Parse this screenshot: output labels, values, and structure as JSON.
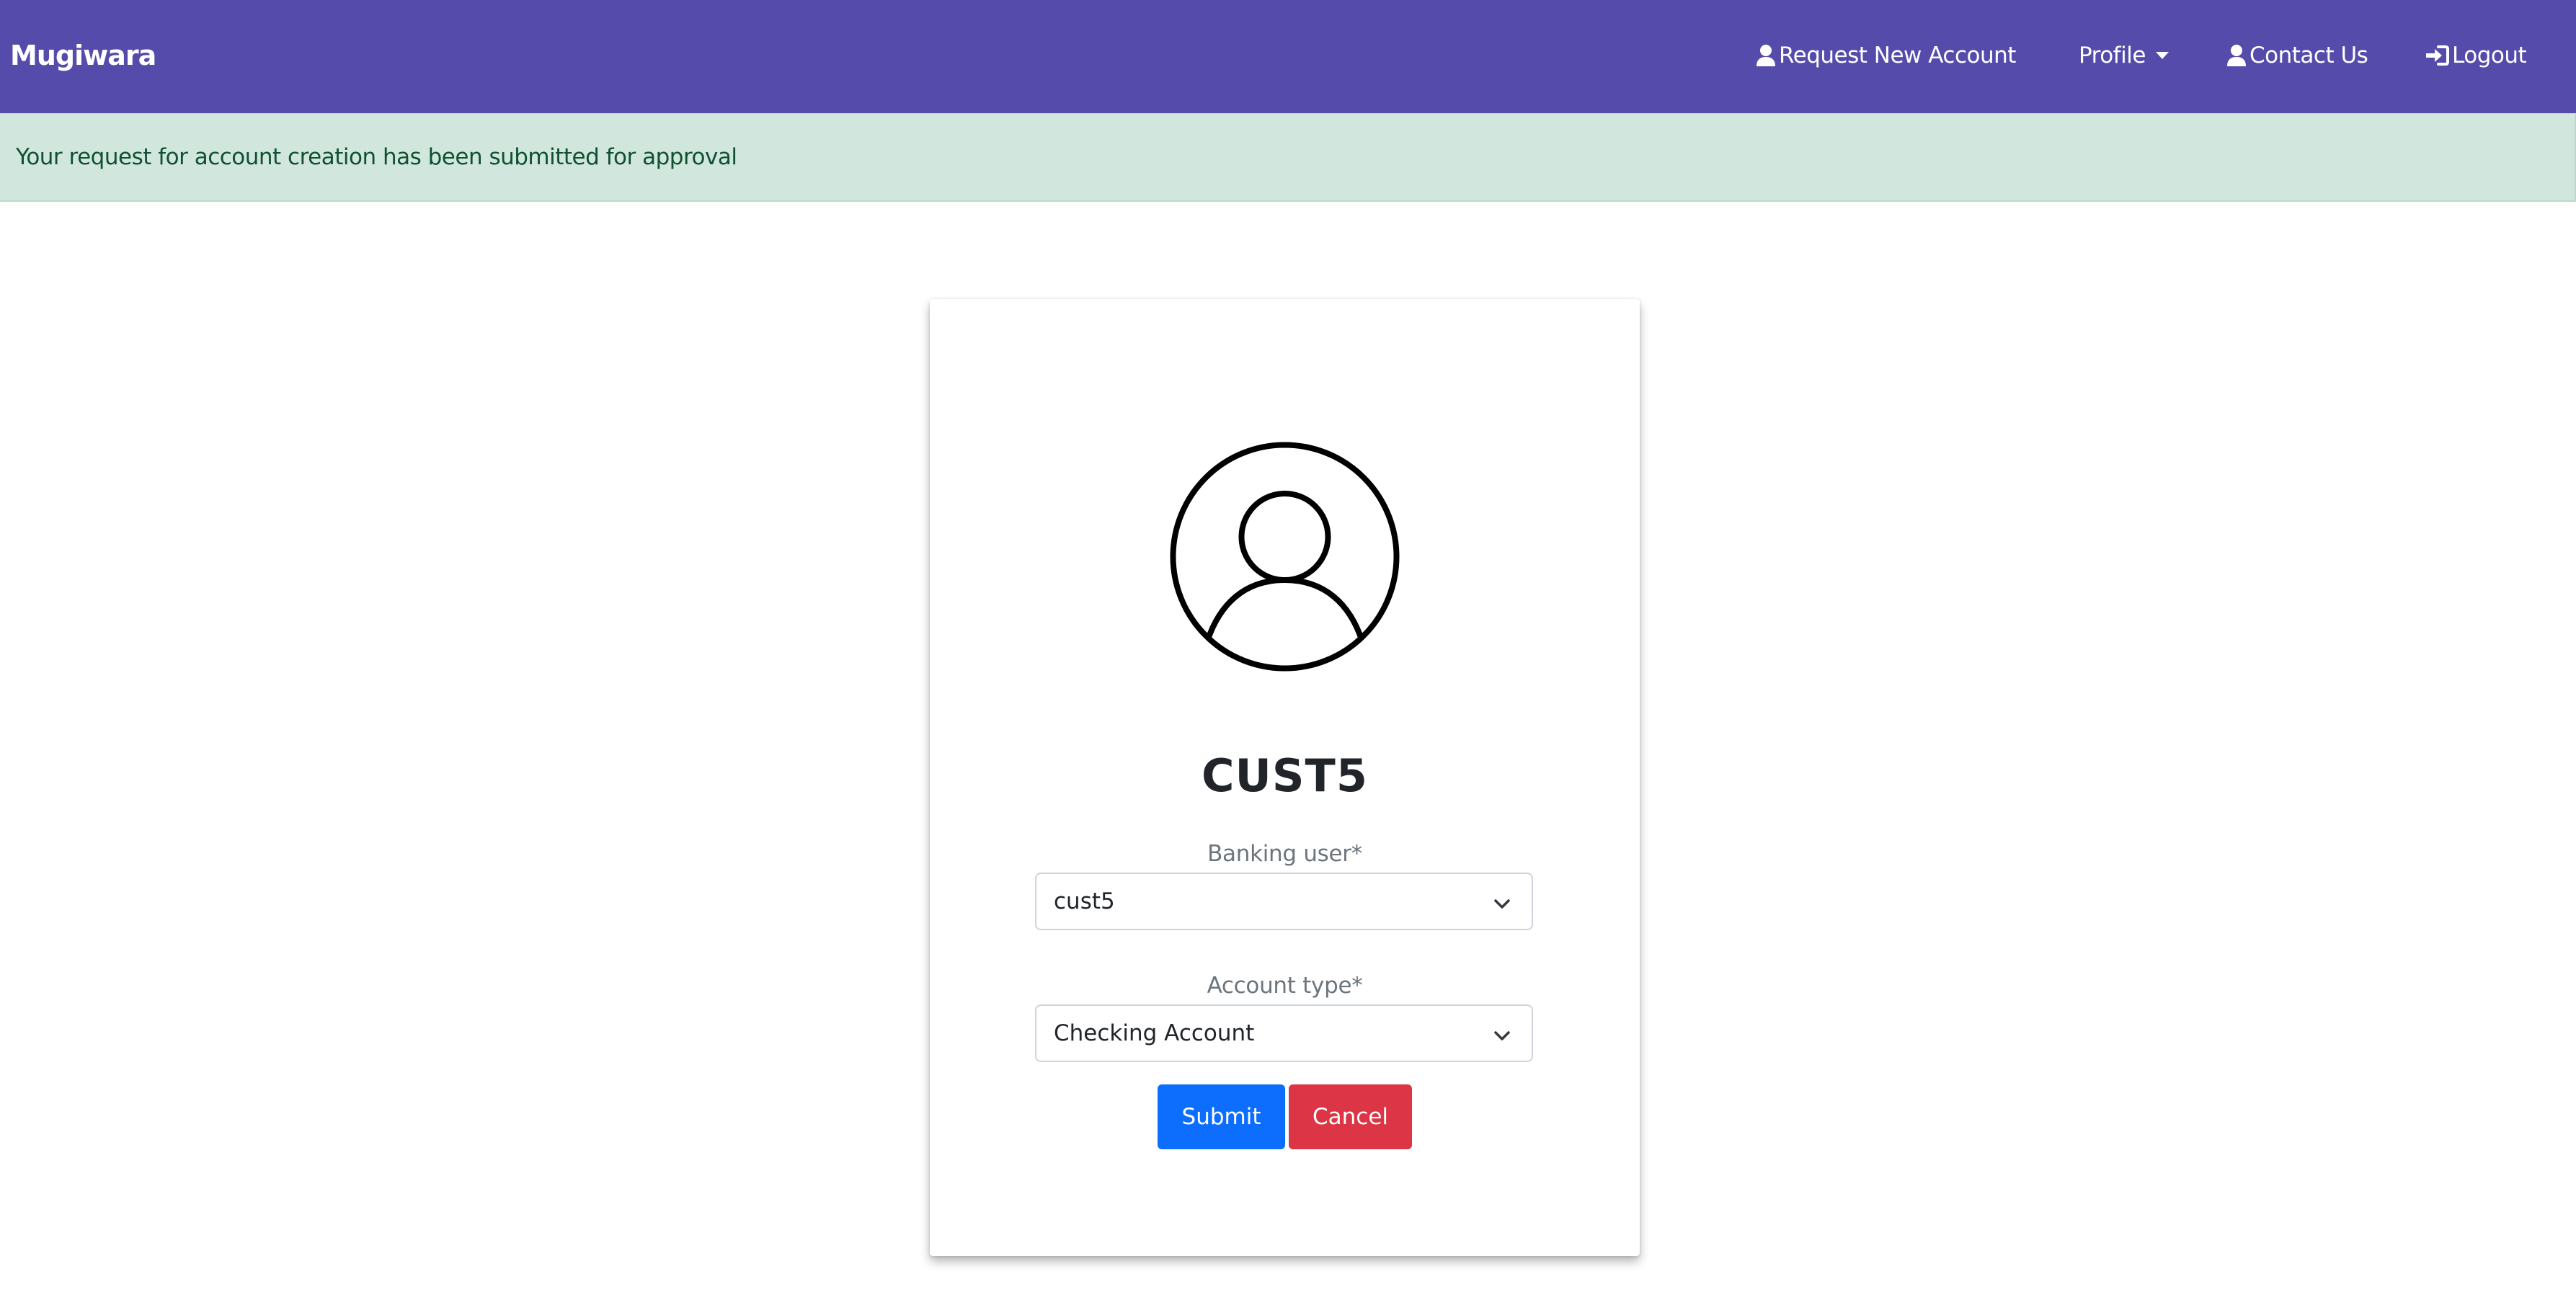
{
  "navbar": {
    "brand": "Mugiwara",
    "items": [
      {
        "label": "Request New Account",
        "icon": "user-icon"
      },
      {
        "label": "Profile",
        "icon": "caret-down-icon"
      },
      {
        "label": "Contact Us",
        "icon": "user-icon"
      },
      {
        "label": "Logout",
        "icon": "sign-in-icon"
      }
    ]
  },
  "alert": {
    "message": "Your request for account creation has been submitted for approval"
  },
  "card": {
    "avatar_icon": "user-circle-icon",
    "username": "CUST5",
    "banking_user": {
      "label": "Banking user*",
      "selected": "cust5"
    },
    "account_type": {
      "label": "Account type*",
      "selected": "Checking Account"
    },
    "submit_label": "Submit",
    "cancel_label": "Cancel"
  },
  "colors": {
    "navbar_bg": "#554bab",
    "alert_bg": "#d1e7dd",
    "alert_text": "#0f5132",
    "submit_bg": "#0d6efd",
    "cancel_bg": "#dc3545"
  }
}
